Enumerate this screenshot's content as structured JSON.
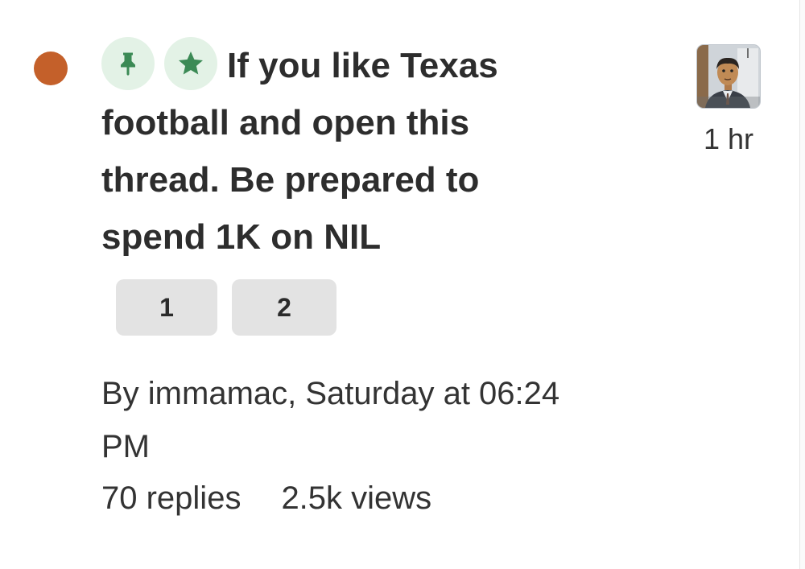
{
  "topic": {
    "unread_color": "#c4602a",
    "badges": [
      {
        "icon": "pin-icon",
        "bg": "#e3f2e6",
        "fg": "#3b8a55"
      },
      {
        "icon": "star-icon",
        "bg": "#e3f2e6",
        "fg": "#3b8a55"
      }
    ],
    "title": "If you like Texas football and open this thread. Be prepared to spend 1K on NIL",
    "pages": [
      "1",
      "2"
    ],
    "byline": "By immamac, Saturday at 06:24 PM",
    "replies": "70 replies",
    "views": "2.5k views",
    "last_post_time": "1 hr",
    "avatar_icon": "user-avatar-icon"
  }
}
